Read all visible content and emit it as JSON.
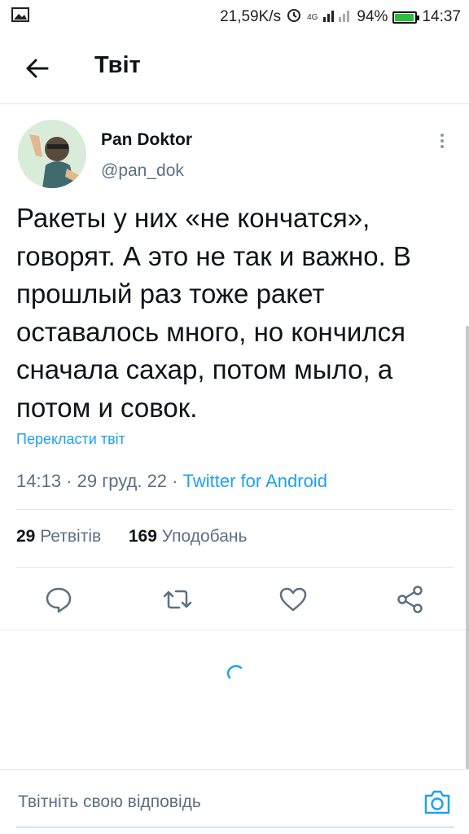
{
  "status_bar": {
    "speed": "21,59K/s",
    "network": "4G",
    "battery": "94%",
    "battery_level": 0.94,
    "time": "14:37"
  },
  "header": {
    "title": "Твіт"
  },
  "tweet": {
    "author_name": "Pan Doktor",
    "author_handle": "@pan_dok",
    "text": "Ракеты у них «не кончатся», говорят. А это не так и важно. В прошлый раз тоже ракет оставалось много, но кончился сначала сахар, потом мыло, а потом и совок.",
    "translate_label": "Перекласти твіт",
    "time": "14:13",
    "date": "29 груд. 22",
    "client": "Twitter for Android",
    "retweet_count": "29",
    "retweet_label": "Ретвітів",
    "like_count": "169",
    "like_label": "Уподобань"
  },
  "actions": {
    "reply_icon": "reply-icon",
    "retweet_icon": "retweet-icon",
    "like_icon": "heart-icon",
    "share_icon": "share-icon"
  },
  "reply_bar": {
    "placeholder": "Твітніть свою відповідь"
  },
  "colors": {
    "accent": "#1da1f2",
    "secondary_text": "#5b7083",
    "divider": "#e1e8ed"
  }
}
